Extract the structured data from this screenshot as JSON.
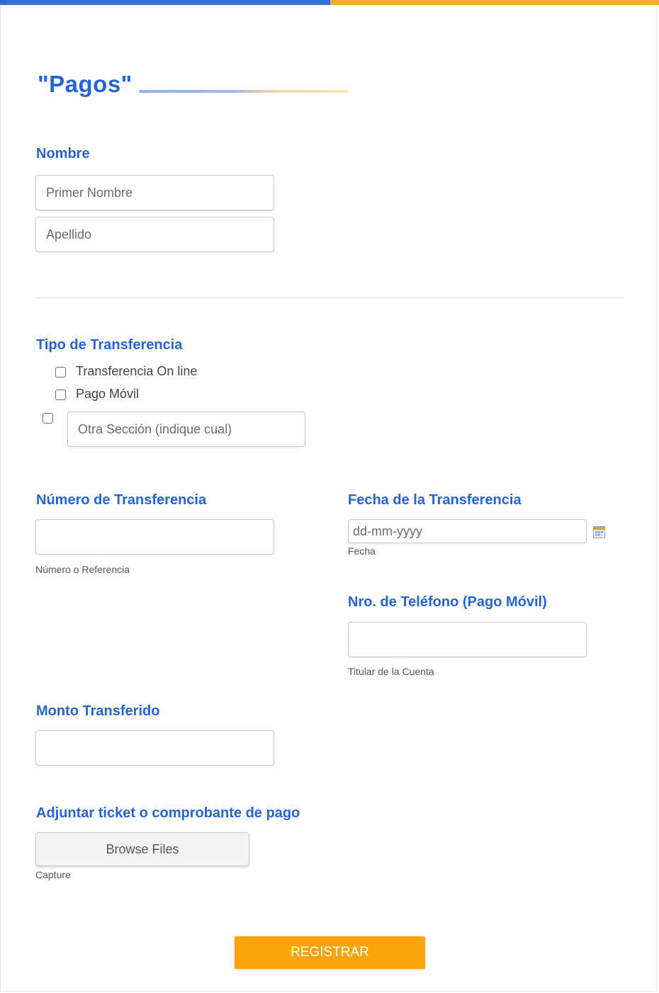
{
  "form": {
    "title": "\"Pagos\"",
    "submit_label": "REGISTRAR"
  },
  "colors": {
    "accent_blue": "#2563d8",
    "top_bar_blue": "#2f6fdc",
    "top_bar_orange": "#f7a93a",
    "submit_orange": "#fba30a"
  },
  "nombre": {
    "label": "Nombre",
    "first_placeholder": "Primer Nombre",
    "last_placeholder": "Apellido"
  },
  "tipo": {
    "label": "Tipo de Transferencia",
    "options": [
      "Transferencia On line",
      "Pago Móvil"
    ],
    "other_placeholder": "Otra Sección (indique cual)"
  },
  "numero": {
    "label": "Número de Transferencia",
    "sublabel": "Número o Referencia"
  },
  "fecha": {
    "label": "Fecha de la Transferencia",
    "placeholder": "dd-mm-yyyy",
    "sublabel": "Fecha",
    "icon": "calendar-icon"
  },
  "telefono": {
    "label": "Nro. de Teléfono (Pago Móvil)",
    "sublabel": "Titular de la Cuenta"
  },
  "monto": {
    "label": "Monto Transferido"
  },
  "adjuntar": {
    "label": "Adjuntar ticket o comprobante de pago",
    "button_label": "Browse Files",
    "sublabel": "Capture"
  }
}
